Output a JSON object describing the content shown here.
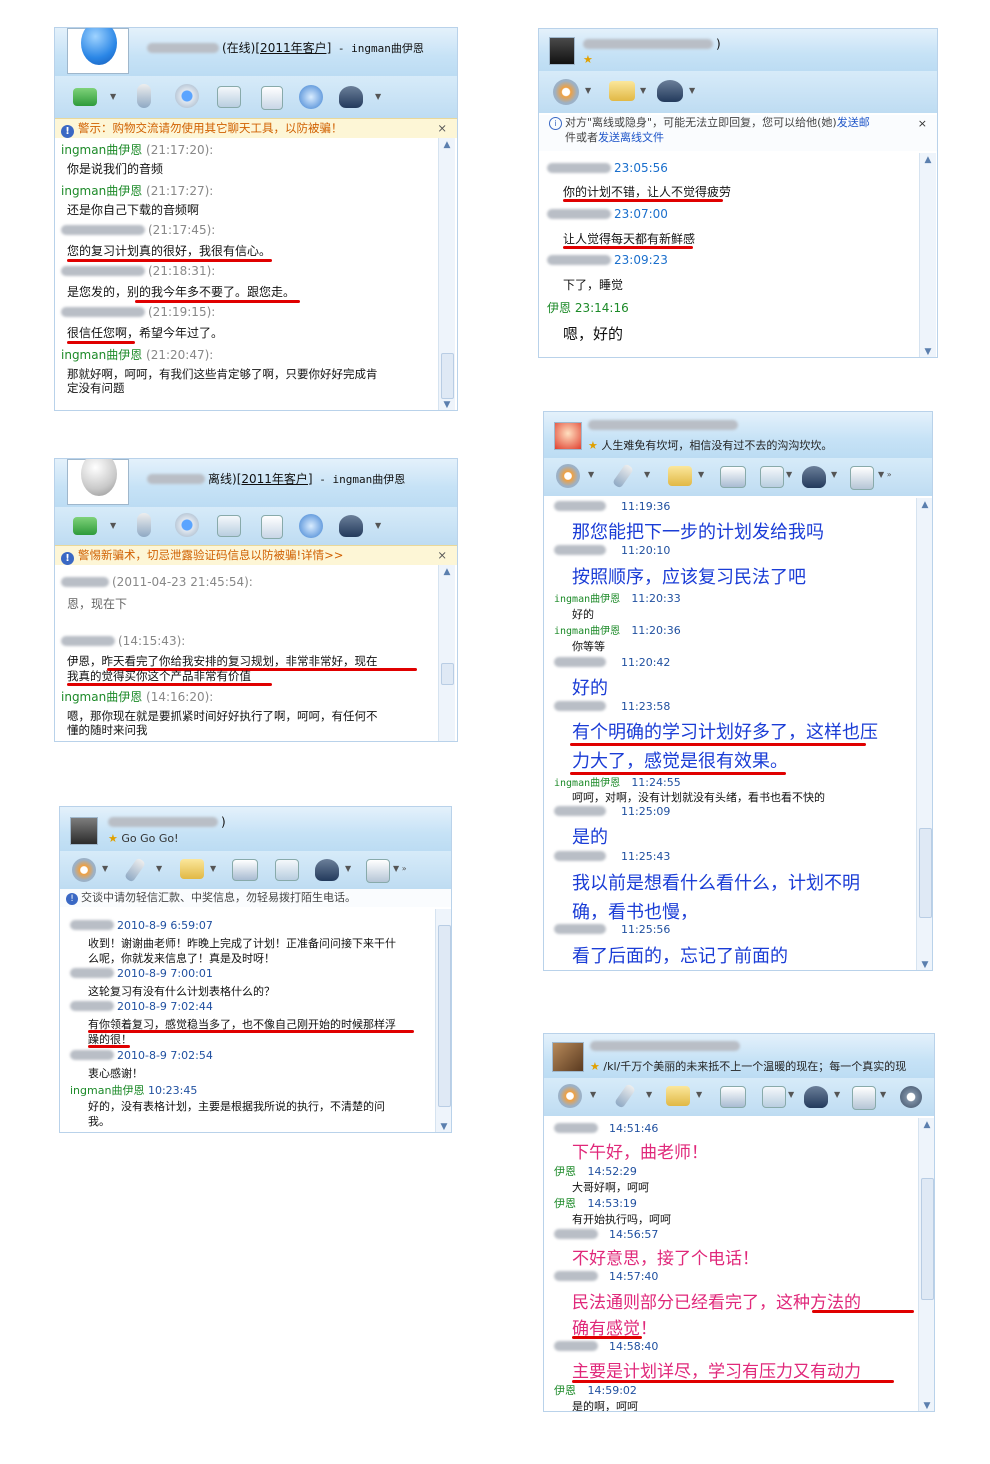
{
  "w1": {
    "title": "(在线)",
    "customer": "[2011年客户]",
    "agent": " - ingman曲伊恩",
    "warning": "警示：购物交流请勿使用其它聊天工具，以防被骗！",
    "close": "×",
    "messages": [
      {
        "name": "ingman曲伊恩",
        "time": "(21:17:20):",
        "text": "你是说我们的音频"
      },
      {
        "name": "ingman曲伊恩",
        "time": "(21:17:27):",
        "text": "还是你自己下载的音频啊"
      },
      {
        "name": "",
        "time": "(21:17:45):",
        "text": "您的复习计划真的很好，我很有信心。"
      },
      {
        "name": "",
        "time": "(21:18:31):",
        "text": "是您发的，别的我今年多不要了。跟您走。"
      },
      {
        "name": "",
        "time": "(21:19:15):",
        "text": "很信任您啊，希望今年过了。"
      },
      {
        "name": "ingman曲伊恩",
        "time": "(21:20:47):",
        "text": "那就好啊，呵呵，有我们这些肯定够了啊，只要你好好完成肯"
      },
      {
        "name": "",
        "time": "",
        "text": "定没有问题"
      }
    ]
  },
  "w2": {
    "title": "离线)",
    "customer": "[2011年客户]",
    "agent": " - ingman曲伊恩",
    "warning": "警惕新骗术，切忌泄露验证码信息以防被骗!详情>>",
    "close": "×",
    "messages": [
      {
        "name": "",
        "time": "(2011-04-23 21:45:54):",
        "text": "恩，现在下"
      },
      {
        "name": "",
        "time": "(14:15:43):",
        "text": "伊恩，昨天看完了你给我安排的复习规划，非常非常好，现在"
      },
      {
        "name": "",
        "time": "",
        "text": "我真的觉得买你这个产品非常有价值"
      },
      {
        "name": "ingman曲伊恩",
        "time": "(14:16:20):",
        "text": "嗯，那你现在就是要抓紧时间好好执行了啊，呵呵，有任何不"
      },
      {
        "name": "",
        "time": "",
        "text": "懂的随时来问我"
      }
    ]
  },
  "w3": {
    "signature": "Go Go Go!",
    "notice": "交谈中请勿轻信汇款、中奖信息，勿轻易拨打陌生电话。",
    "messages": [
      {
        "name": "",
        "time": "2010-8-9 6:59:07",
        "text": "收到！谢谢曲老师！昨晚上完成了计划！正准备问问接下来干什"
      },
      {
        "name": "",
        "time": "",
        "text": "么呢，你就发来信息了！真是及时呀！"
      },
      {
        "name": "",
        "time": "2010-8-9 7:00:01",
        "text": "这轮复习有没有什么计划表格什么的？"
      },
      {
        "name": "",
        "time": "2010-8-9 7:02:44",
        "text": "有你领着复习，感觉稳当多了，也不像自己刚开始的时候那样浮"
      },
      {
        "name": "",
        "time": "",
        "text": "躁的很！"
      },
      {
        "name": "",
        "time": "2010-8-9 7:02:54",
        "text": "衷心感谢！"
      },
      {
        "name": "ingman曲伊恩",
        "time": "10:23:45",
        "text": "好的，没有表格计划，主要是根据我所说的执行，不清楚的问"
      },
      {
        "name": "",
        "time": "",
        "text": "我。"
      }
    ]
  },
  "w4": {
    "title": ")",
    "notice_prefix": "对方\"离线或隐身\"，可能无法立即回复，您可以给他(她)",
    "notice_link1": "发送邮",
    "notice_mid": "件或者",
    "notice_link2": "发送离线文件",
    "close": "×",
    "messages": [
      {
        "name": "",
        "time": "23:05:56",
        "text": "你的计划不错，让人不觉得疲劳"
      },
      {
        "name": "",
        "time": "23:07:00",
        "text": "让人觉得每天都有新鲜感"
      },
      {
        "name": "",
        "time": "23:09:23",
        "text": "下了，睡觉"
      },
      {
        "name": "伊恩",
        "time": "23:14:16",
        "text": "嗯，好的"
      }
    ]
  },
  "w5": {
    "signature": "人生难免有坎坷，相信没有过不去的沟沟坎坎。",
    "messages": [
      {
        "name": "",
        "time": "11:19:36",
        "text": "那您能把下一步的计划发给我吗"
      },
      {
        "name": "",
        "time": "11:20:10",
        "text": "按照顺序，应该复习民法了吧"
      },
      {
        "name": "ingman曲伊恩",
        "time": "11:20:33",
        "text": "好的"
      },
      {
        "name": "ingman曲伊恩",
        "time": "11:20:36",
        "text": "你等等"
      },
      {
        "name": "",
        "time": "11:20:42",
        "text": "好的"
      },
      {
        "name": "",
        "time": "11:23:58",
        "text": "有个明确的学习计划好多了，这样也压"
      },
      {
        "name": "",
        "time": "",
        "text": "力大了，感觉是很有效果。"
      },
      {
        "name": "ingman曲伊恩",
        "time": "11:24:55",
        "text": "呵呵，对啊，没有计划就没有头绪，看书也看不快的"
      },
      {
        "name": "",
        "time": "11:25:09",
        "text": "是的"
      },
      {
        "name": "",
        "time": "11:25:43",
        "text": "我以前是想看什么看什么，计划不明"
      },
      {
        "name": "",
        "time": "",
        "text": "确，看书也慢，"
      },
      {
        "name": "",
        "time": "11:25:56",
        "text": "看了后面的，忘记了前面的"
      }
    ]
  },
  "w6": {
    "signature": "/kl/千万个美丽的未来抵不上一个温暖的现在；每一个真实的现",
    "messages": [
      {
        "name": "",
        "time": "14:51:46",
        "text": "下午好，曲老师！"
      },
      {
        "name": "伊恩",
        "time": "14:52:29",
        "text": "大哥好啊，呵呵"
      },
      {
        "name": "伊恩",
        "time": "14:53:19",
        "text": "有开始执行吗，呵呵"
      },
      {
        "name": "",
        "time": "14:56:57",
        "text": "不好意思，接了个电话！"
      },
      {
        "name": "",
        "time": "14:57:40",
        "text": "民法通则部分已经看完了，这种方法的"
      },
      {
        "name": "",
        "time": "",
        "text": "确有感觉！"
      },
      {
        "name": "",
        "time": "14:58:40",
        "text": "主要是计划详尽，学习有压力又有动力"
      },
      {
        "name": "伊恩",
        "time": "14:59:02",
        "text": "是的啊，呵呵"
      }
    ]
  },
  "colors": {
    "green": "#1c8a28",
    "blue": "#1a3cd6",
    "pink": "#e0287a",
    "underline": "#e00000"
  },
  "icons": [
    "transfer-icon",
    "mic-icon",
    "camera-icon",
    "add-icon",
    "image-icon",
    "browser-icon",
    "service-icon",
    "mail-icon",
    "app-icon",
    "settings-icon"
  ]
}
